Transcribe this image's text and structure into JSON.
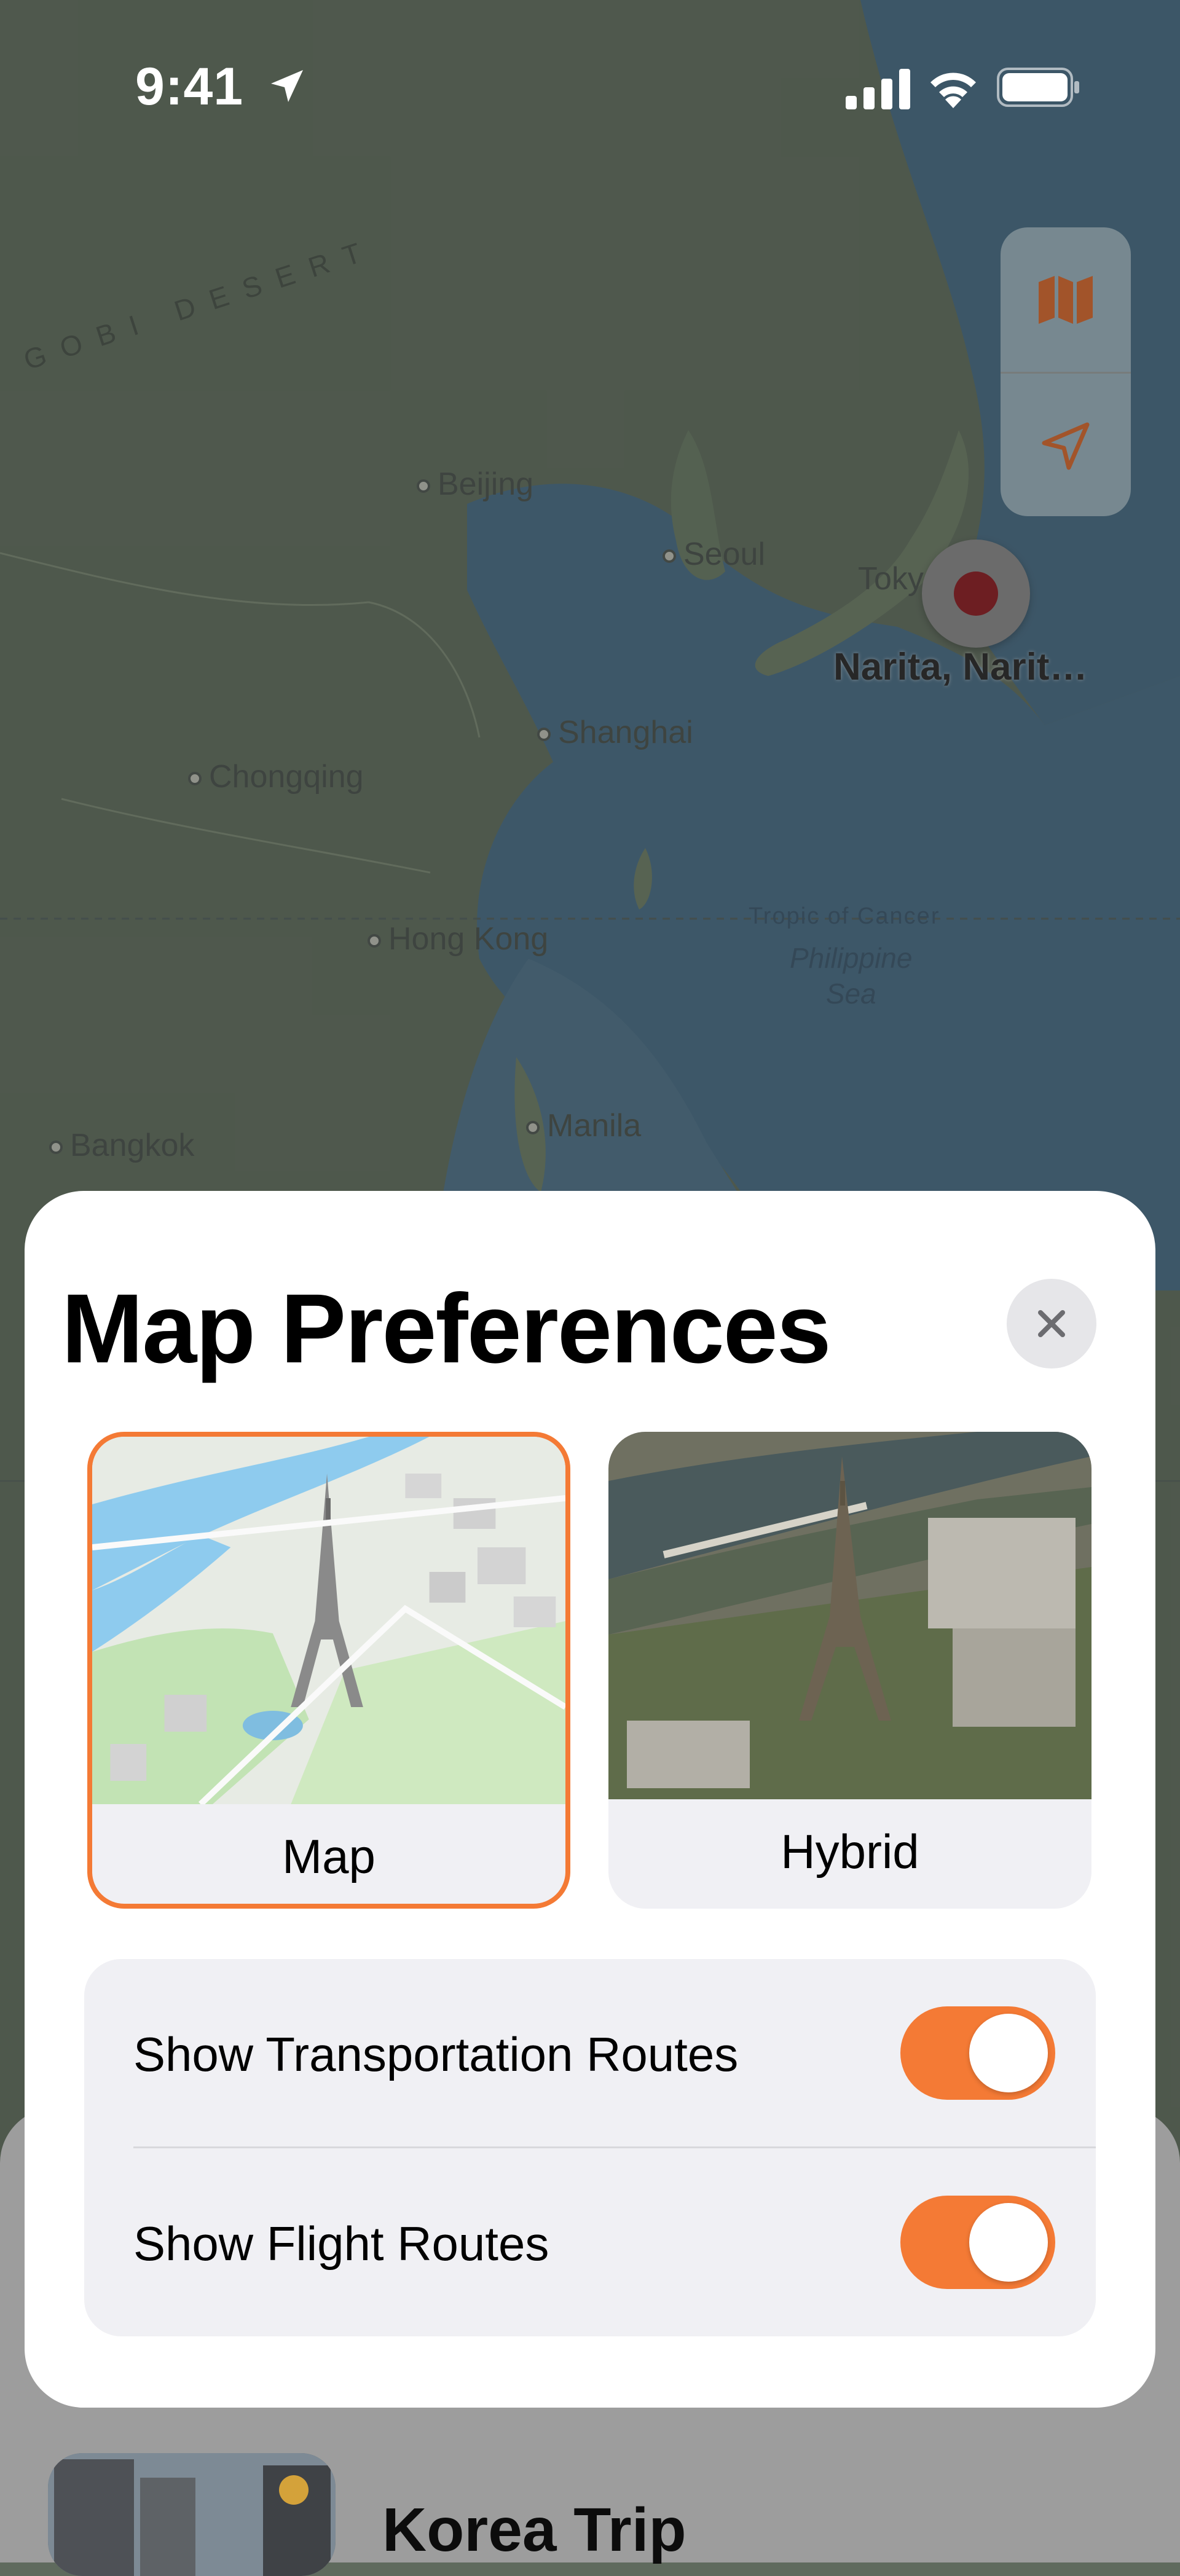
{
  "status_bar": {
    "time": "9:41"
  },
  "map": {
    "region_label": "GOBI DESERT",
    "cities": [
      "Beijing",
      "Seoul",
      "Tokyo",
      "Shanghai",
      "Chongqing",
      "Hong Kong",
      "Manila",
      "Bangkok"
    ],
    "tropic_label": "Tropic of Cancer",
    "sea_label": "Philippine\nSea",
    "pin_label": "Narita, Narit…"
  },
  "sheet": {
    "title": "Map Preferences",
    "map_types": [
      {
        "label": "Map",
        "selected": true
      },
      {
        "label": "Hybrid",
        "selected": false
      }
    ],
    "toggles": [
      {
        "label": "Show Transportation Routes",
        "on": true
      },
      {
        "label": "Show Flight Routes",
        "on": true
      }
    ]
  },
  "background_list": {
    "trip_title": "Korea Trip"
  },
  "colors": {
    "accent": "#f47a35",
    "sheet": "#ffffff",
    "grouped_bg": "#f0f0f4"
  }
}
